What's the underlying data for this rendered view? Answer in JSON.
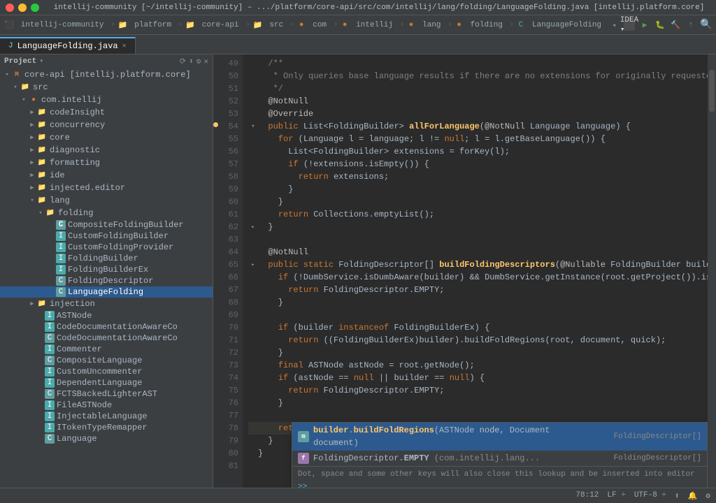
{
  "titleBar": {
    "title": "intellij-community [~/intellij-community] – .../platform/core-api/src/com/intellij/lang/folding/LanguageFolding.java [intellij.platform.core]"
  },
  "toolbar": {
    "items": [
      {
        "label": "intellij-community",
        "icon": "project-icon"
      },
      {
        "label": "platform",
        "icon": "folder-icon"
      },
      {
        "label": "core-api",
        "icon": "folder-icon"
      },
      {
        "label": "src",
        "icon": "source-icon"
      },
      {
        "label": "com",
        "icon": "package-icon"
      },
      {
        "label": "intellij",
        "icon": "package-icon"
      },
      {
        "label": "lang",
        "icon": "package-icon"
      },
      {
        "label": "folding",
        "icon": "package-icon"
      },
      {
        "label": "LanguageFolding",
        "icon": "class-icon"
      }
    ],
    "ideaButton": "IDEA",
    "searchIcon": "🔍"
  },
  "projectPanel": {
    "title": "Project",
    "root": "core-api [intellij.platform.core]",
    "items": [
      {
        "id": "src",
        "label": "src",
        "type": "src",
        "indent": 1,
        "expanded": true
      },
      {
        "id": "com.intellij",
        "label": "com.intellij",
        "type": "package",
        "indent": 2,
        "expanded": true
      },
      {
        "id": "codeInsight",
        "label": "codeInsight",
        "type": "folder",
        "indent": 3,
        "expanded": false
      },
      {
        "id": "concurrency",
        "label": "concurrency",
        "type": "folder",
        "indent": 3,
        "expanded": false
      },
      {
        "id": "core",
        "label": "core",
        "type": "folder",
        "indent": 3,
        "expanded": false
      },
      {
        "id": "diagnostic",
        "label": "diagnostic",
        "type": "folder",
        "indent": 3,
        "expanded": false
      },
      {
        "id": "formatting",
        "label": "formatting",
        "type": "folder",
        "indent": 3,
        "expanded": false
      },
      {
        "id": "ide",
        "label": "ide",
        "type": "folder",
        "indent": 3,
        "expanded": false
      },
      {
        "id": "injected.editor",
        "label": "injected.editor",
        "type": "folder",
        "indent": 3,
        "expanded": false
      },
      {
        "id": "lang",
        "label": "lang",
        "type": "folder",
        "indent": 3,
        "expanded": true
      },
      {
        "id": "folding",
        "label": "folding",
        "type": "folder",
        "indent": 4,
        "expanded": true
      },
      {
        "id": "CompositeFoldingBuilder",
        "label": "CompositeFoldingBuilder",
        "type": "class",
        "indent": 5
      },
      {
        "id": "CustomFoldingBuilder",
        "label": "CustomFoldingBuilder",
        "type": "interface",
        "indent": 5
      },
      {
        "id": "CustomFoldingProvider",
        "label": "CustomFoldingProvider",
        "type": "interface",
        "indent": 5
      },
      {
        "id": "FoldingBuilder",
        "label": "FoldingBuilder",
        "type": "interface",
        "indent": 5
      },
      {
        "id": "FoldingBuilderEx",
        "label": "FoldingBuilderEx",
        "type": "interface",
        "indent": 5
      },
      {
        "id": "FoldingDescriptor",
        "label": "FoldingDescriptor",
        "type": "class",
        "indent": 5
      },
      {
        "id": "LanguageFolding",
        "label": "LanguageFolding",
        "type": "class",
        "indent": 5,
        "selected": true
      },
      {
        "id": "injection",
        "label": "injection",
        "type": "folder",
        "indent": 3,
        "expanded": false
      },
      {
        "id": "ASTNode",
        "label": "ASTNode",
        "type": "interface",
        "indent": 4
      },
      {
        "id": "CodeDocumentationAwareCo1",
        "label": "CodeDocumentationAwareCo",
        "type": "interface",
        "indent": 4
      },
      {
        "id": "CodeDocumentationAwareCo2",
        "label": "CodeDocumentationAwareCo",
        "type": "class",
        "indent": 4
      },
      {
        "id": "Commenter",
        "label": "Commenter",
        "type": "interface",
        "indent": 4
      },
      {
        "id": "CompositeLanguage",
        "label": "CompositeLanguage",
        "type": "class",
        "indent": 4
      },
      {
        "id": "CustomUncommenter",
        "label": "CustomUncommenter",
        "type": "interface",
        "indent": 4
      },
      {
        "id": "DependentLanguage",
        "label": "DependentLanguage",
        "type": "interface",
        "indent": 4
      },
      {
        "id": "FCTSBackedLighterAST",
        "label": "FCTSBackedLighterAST",
        "type": "class",
        "indent": 4
      },
      {
        "id": "FileASTNode",
        "label": "FileASTNode",
        "type": "interface",
        "indent": 4
      },
      {
        "id": "InjectableLanguage",
        "label": "InjectableLanguage",
        "type": "interface",
        "indent": 4
      },
      {
        "id": "ITokenTypeRemapper",
        "label": "ITokenTypeRemapper",
        "type": "interface",
        "indent": 4
      },
      {
        "id": "Language",
        "label": "Language",
        "type": "class",
        "indent": 4
      }
    ]
  },
  "editorTab": {
    "filename": "LanguageFolding.java",
    "icon": "java-icon"
  },
  "codeLines": [
    {
      "num": 49,
      "fold": false,
      "content": "  /**",
      "type": "comment"
    },
    {
      "num": 50,
      "fold": false,
      "content": "   * Only queries base language results if there are no extensions for originally requested...",
      "type": "comment"
    },
    {
      "num": 51,
      "fold": false,
      "content": "   */",
      "type": "comment"
    },
    {
      "num": 52,
      "fold": false,
      "content": "  @NotNull",
      "type": "annotation"
    },
    {
      "num": 53,
      "fold": false,
      "content": "  @Override",
      "type": "annotation"
    },
    {
      "num": 54,
      "fold": false,
      "content": "  public List<FoldingBuilder> allForLanguage(@NotNull Language language) {",
      "type": "code",
      "gutter": true
    },
    {
      "num": 55,
      "fold": false,
      "content": "    for (Language l = language; l != null; l = l.getBaseLanguage()) {",
      "type": "code"
    },
    {
      "num": 56,
      "fold": false,
      "content": "      List<FoldingBuilder> extensions = forKey(l);",
      "type": "code"
    },
    {
      "num": 57,
      "fold": false,
      "content": "      if (!extensions.isEmpty()) {",
      "type": "code"
    },
    {
      "num": 58,
      "fold": false,
      "content": "        return extensions;",
      "type": "code"
    },
    {
      "num": 59,
      "fold": false,
      "content": "      }",
      "type": "code"
    },
    {
      "num": 60,
      "fold": false,
      "content": "    }",
      "type": "code"
    },
    {
      "num": 61,
      "fold": false,
      "content": "    return Collections.emptyList();",
      "type": "code"
    },
    {
      "num": 62,
      "fold": true,
      "content": "  }",
      "type": "code"
    },
    {
      "num": 63,
      "fold": false,
      "content": "",
      "type": "empty"
    },
    {
      "num": 64,
      "fold": false,
      "content": "  @NotNull",
      "type": "annotation"
    },
    {
      "num": 65,
      "fold": true,
      "content": "  public static FoldingDescriptor[] buildFoldingDescriptors(@Nullable FoldingBuilder builder...",
      "type": "code"
    },
    {
      "num": 66,
      "fold": false,
      "content": "    if (!DumbService.isDumbAware(builder) && DumbService.getInstance(root.getProject()).isDu...",
      "type": "code"
    },
    {
      "num": 67,
      "fold": false,
      "content": "      return FoldingDescriptor.EMPTY;",
      "type": "code"
    },
    {
      "num": 68,
      "fold": false,
      "content": "    }",
      "type": "code"
    },
    {
      "num": 69,
      "fold": false,
      "content": "",
      "type": "empty"
    },
    {
      "num": 70,
      "fold": false,
      "content": "    if (builder instanceof FoldingBuilderEx) {",
      "type": "code"
    },
    {
      "num": 71,
      "fold": false,
      "content": "      return ((FoldingBuilderEx)builder).buildFoldRegions(root, document, quick);",
      "type": "code"
    },
    {
      "num": 72,
      "fold": false,
      "content": "    }",
      "type": "code"
    },
    {
      "num": 73,
      "fold": false,
      "content": "    final ASTNode astNode = root.getNode();",
      "type": "code"
    },
    {
      "num": 74,
      "fold": false,
      "content": "    if (astNode == null || builder == null) {",
      "type": "code"
    },
    {
      "num": 75,
      "fold": false,
      "content": "      return FoldingDescriptor.EMPTY;",
      "type": "code"
    },
    {
      "num": 76,
      "fold": false,
      "content": "    }",
      "type": "code"
    },
    {
      "num": 77,
      "fold": false,
      "content": "",
      "type": "empty"
    },
    {
      "num": 78,
      "fold": false,
      "content": "    return |",
      "type": "cursor"
    },
    {
      "num": 79,
      "fold": false,
      "content": "  }",
      "type": "code"
    },
    {
      "num": 80,
      "fold": false,
      "content": "}",
      "type": "code"
    },
    {
      "num": 81,
      "fold": false,
      "content": "",
      "type": "empty"
    }
  ],
  "autocomplete": {
    "items": [
      {
        "id": "ac1",
        "iconType": "method",
        "text": "builder.buildFoldRegions(ASTNode node, Document document)",
        "type": "FoldingDescriptor[]",
        "selected": true
      },
      {
        "id": "ac2",
        "iconType": "field",
        "text": "FoldingDescriptor.EMPTY",
        "typeShort": "(com.intellij.lang...",
        "type": "FoldingDescriptor[]",
        "selected": false
      }
    ],
    "hint": "Dot, space and some other keys will also close this lookup and be inserted into editor",
    "hintLink": ">>"
  },
  "statusBar": {
    "left": "",
    "position": "78:12",
    "lf": "LF ÷",
    "encoding": "UTF-8 ÷",
    "rightIcons": [
      "git-icon",
      "notification-icon",
      "settings-icon"
    ]
  }
}
